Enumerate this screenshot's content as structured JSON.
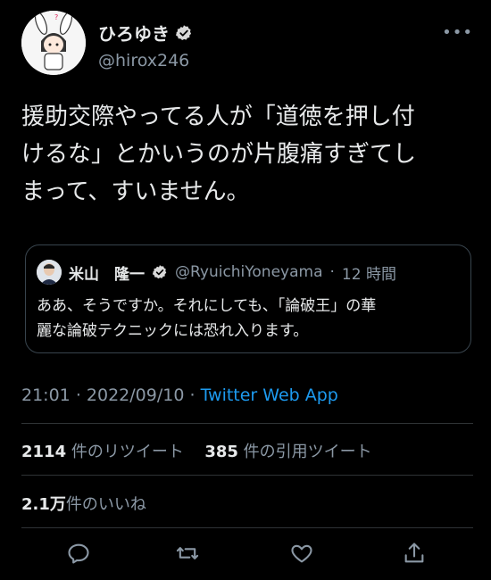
{
  "user": {
    "display_name": "ひろゆき",
    "handle": "@hirox246",
    "verified_icon": "verified-badge-icon"
  },
  "tweet": {
    "text": "援助交際やってる人が「道徳を押し付\nけるな」とかいうのが片腹痛すぎてし\nまって、すいません。"
  },
  "quoted": {
    "name": "米山　隆一",
    "handle": "@RyuichiYoneyama",
    "separator": "·",
    "time": "12 時間",
    "text": "ああ、そうですか。それにしても、「論破王」の華\n麗な論破テクニックには恐れ入ります。"
  },
  "meta": {
    "time": "21:01",
    "dot1": "·",
    "date": "2022/09/10",
    "dot2": "·",
    "app": "Twitter Web App"
  },
  "stats": {
    "retweets_num": "2114",
    "retweets_label": " 件のリツイート",
    "quotes_num": "385",
    "quotes_label": " 件の引用ツイート",
    "likes_num": "2.1万",
    "likes_label": "件のいいね"
  },
  "colors": {
    "background": "#000000",
    "text": "#e7e9ea",
    "secondary": "#8b98a5",
    "accent": "#1d9bf0",
    "divider": "#2f3336"
  }
}
